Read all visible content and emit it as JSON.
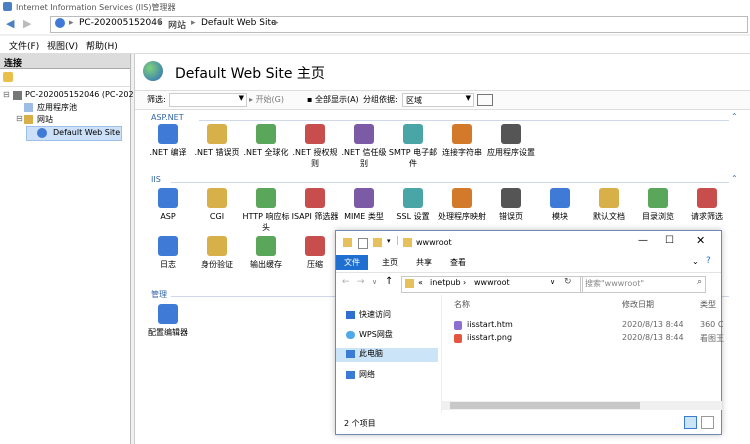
{
  "window": {
    "title": "Internet Information Services (IIS)管理器"
  },
  "address": {
    "segments": [
      "PC-202005152046",
      "网站",
      "Default Web Site"
    ]
  },
  "menu": {
    "items": [
      "文件(F)",
      "视图(V)",
      "帮助(H)"
    ]
  },
  "connections": {
    "header": "连接",
    "tree": [
      {
        "label": "PC-202005152046 (PC-202"
      },
      {
        "label": "应用程序池"
      },
      {
        "label": "网站"
      },
      {
        "label": "Default Web Site"
      }
    ]
  },
  "main": {
    "title": "Default Web Site 主页",
    "filter": {
      "filter_label": "筛选:",
      "start_label": "开始(G)",
      "show_all_label": "全部显示(A)",
      "group_label": "分组依据:",
      "group_value": "区域"
    },
    "sections": [
      {
        "name": "ASP.NET"
      },
      {
        "name": "IIS"
      },
      {
        "name": "管理"
      }
    ],
    "aspnet_items": [
      ".NET 编译",
      ".NET 错误页",
      ".NET 全球化",
      ".NET 授权规则",
      ".NET 信任级别",
      "SMTP 电子邮件",
      "连接字符串",
      "应用程序设置"
    ],
    "iis_items_row1": [
      "ASP",
      "CGI",
      "HTTP 响应标头",
      "ISAPI 筛选器",
      "MIME 类型",
      "SSL 设置",
      "处理程序映射",
      "错误页",
      "模块",
      "默认文档",
      "目录浏览",
      "请求筛选"
    ],
    "iis_items_row2": [
      "日志",
      "身份验证",
      "输出缓存",
      "压缩"
    ],
    "mgmt_items": [
      "配置编辑器"
    ]
  },
  "explorer": {
    "title": "wwwroot",
    "tabs": [
      "文件",
      "主页",
      "共享",
      "查看"
    ],
    "path": [
      "inetpub",
      "wwwroot"
    ],
    "search_placeholder": "搜索\"wwwroot\"",
    "nav": [
      "快速访问",
      "WPS网盘",
      "此电脑",
      "网络"
    ],
    "columns": [
      "名称",
      "修改日期",
      "类型"
    ],
    "files": [
      {
        "name": "iisstart.htm",
        "date": "2020/8/13 8:44",
        "type": "360 C"
      },
      {
        "name": "iisstart.png",
        "date": "2020/8/13 8:44",
        "type": "看图王"
      }
    ],
    "status": "2 个项目"
  }
}
